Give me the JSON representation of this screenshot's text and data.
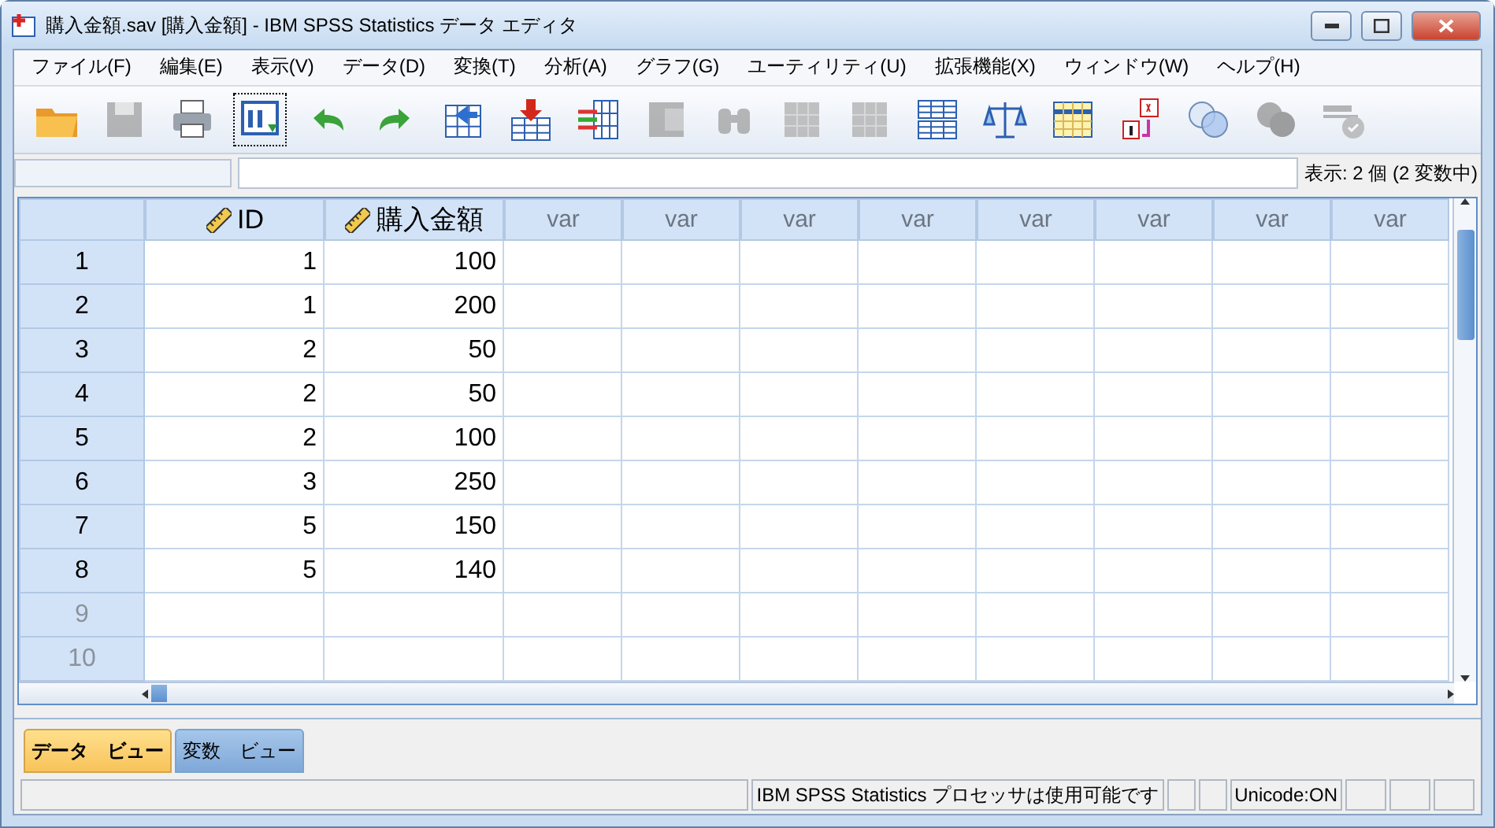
{
  "window": {
    "title": "購入金額.sav [購入金額] - IBM SPSS Statistics データ エディタ"
  },
  "menu": [
    "ファイル(F)",
    "編集(E)",
    "表示(V)",
    "データ(D)",
    "変換(T)",
    "分析(A)",
    "グラフ(G)",
    "ユーティリティ(U)",
    "拡張機能(X)",
    "ウィンドウ(W)",
    "ヘルプ(H)"
  ],
  "toolbar": [
    {
      "kind": "open",
      "disabled": false
    },
    {
      "kind": "save",
      "disabled": true
    },
    {
      "kind": "print",
      "disabled": false
    },
    {
      "kind": "recall",
      "disabled": false
    },
    {
      "kind": "undo",
      "disabled": false
    },
    {
      "kind": "redo",
      "disabled": false
    },
    {
      "kind": "goto-case",
      "disabled": false
    },
    {
      "kind": "goto-var",
      "disabled": false
    },
    {
      "kind": "variables",
      "disabled": false
    },
    {
      "kind": "stats",
      "disabled": true
    },
    {
      "kind": "find",
      "disabled": true
    },
    {
      "kind": "insert-case",
      "disabled": true
    },
    {
      "kind": "insert-var",
      "disabled": true
    },
    {
      "kind": "split",
      "disabled": false
    },
    {
      "kind": "weight",
      "disabled": false
    },
    {
      "kind": "select",
      "disabled": false
    },
    {
      "kind": "labels",
      "disabled": false
    },
    {
      "kind": "sets",
      "disabled": false
    },
    {
      "kind": "sets-filled",
      "disabled": true
    },
    {
      "kind": "spell",
      "disabled": true
    }
  ],
  "cell_bar": {
    "visible_count": "表示: 2 個 (2 変数中)"
  },
  "columns": [
    {
      "name": "ID",
      "kind": "scale"
    },
    {
      "name": "購入金額",
      "kind": "scale"
    },
    {
      "name": "var",
      "kind": "empty"
    },
    {
      "name": "var",
      "kind": "empty"
    },
    {
      "name": "var",
      "kind": "empty"
    },
    {
      "name": "var",
      "kind": "empty"
    },
    {
      "name": "var",
      "kind": "empty"
    },
    {
      "name": "var",
      "kind": "empty"
    },
    {
      "name": "var",
      "kind": "empty"
    },
    {
      "name": "var",
      "kind": "empty"
    }
  ],
  "rows": [
    {
      "number": "1",
      "dimmed": false,
      "cells": [
        "1",
        "100"
      ]
    },
    {
      "number": "2",
      "dimmed": false,
      "cells": [
        "1",
        "200"
      ]
    },
    {
      "number": "3",
      "dimmed": false,
      "cells": [
        "2",
        "50"
      ]
    },
    {
      "number": "4",
      "dimmed": false,
      "cells": [
        "2",
        "50"
      ]
    },
    {
      "number": "5",
      "dimmed": false,
      "cells": [
        "2",
        "100"
      ]
    },
    {
      "number": "6",
      "dimmed": false,
      "cells": [
        "3",
        "250"
      ]
    },
    {
      "number": "7",
      "dimmed": false,
      "cells": [
        "5",
        "150"
      ]
    },
    {
      "number": "8",
      "dimmed": false,
      "cells": [
        "5",
        "140"
      ]
    },
    {
      "number": "9",
      "dimmed": true,
      "cells": []
    },
    {
      "number": "10",
      "dimmed": true,
      "cells": []
    }
  ],
  "tabs": [
    {
      "label": "データ　ビュー",
      "selected": true
    },
    {
      "label": "変数　ビュー",
      "selected": false
    }
  ],
  "status_bar": {
    "processor": "IBM SPSS Statistics プロセッサは使用可能です",
    "unicode": "Unicode:ON"
  }
}
